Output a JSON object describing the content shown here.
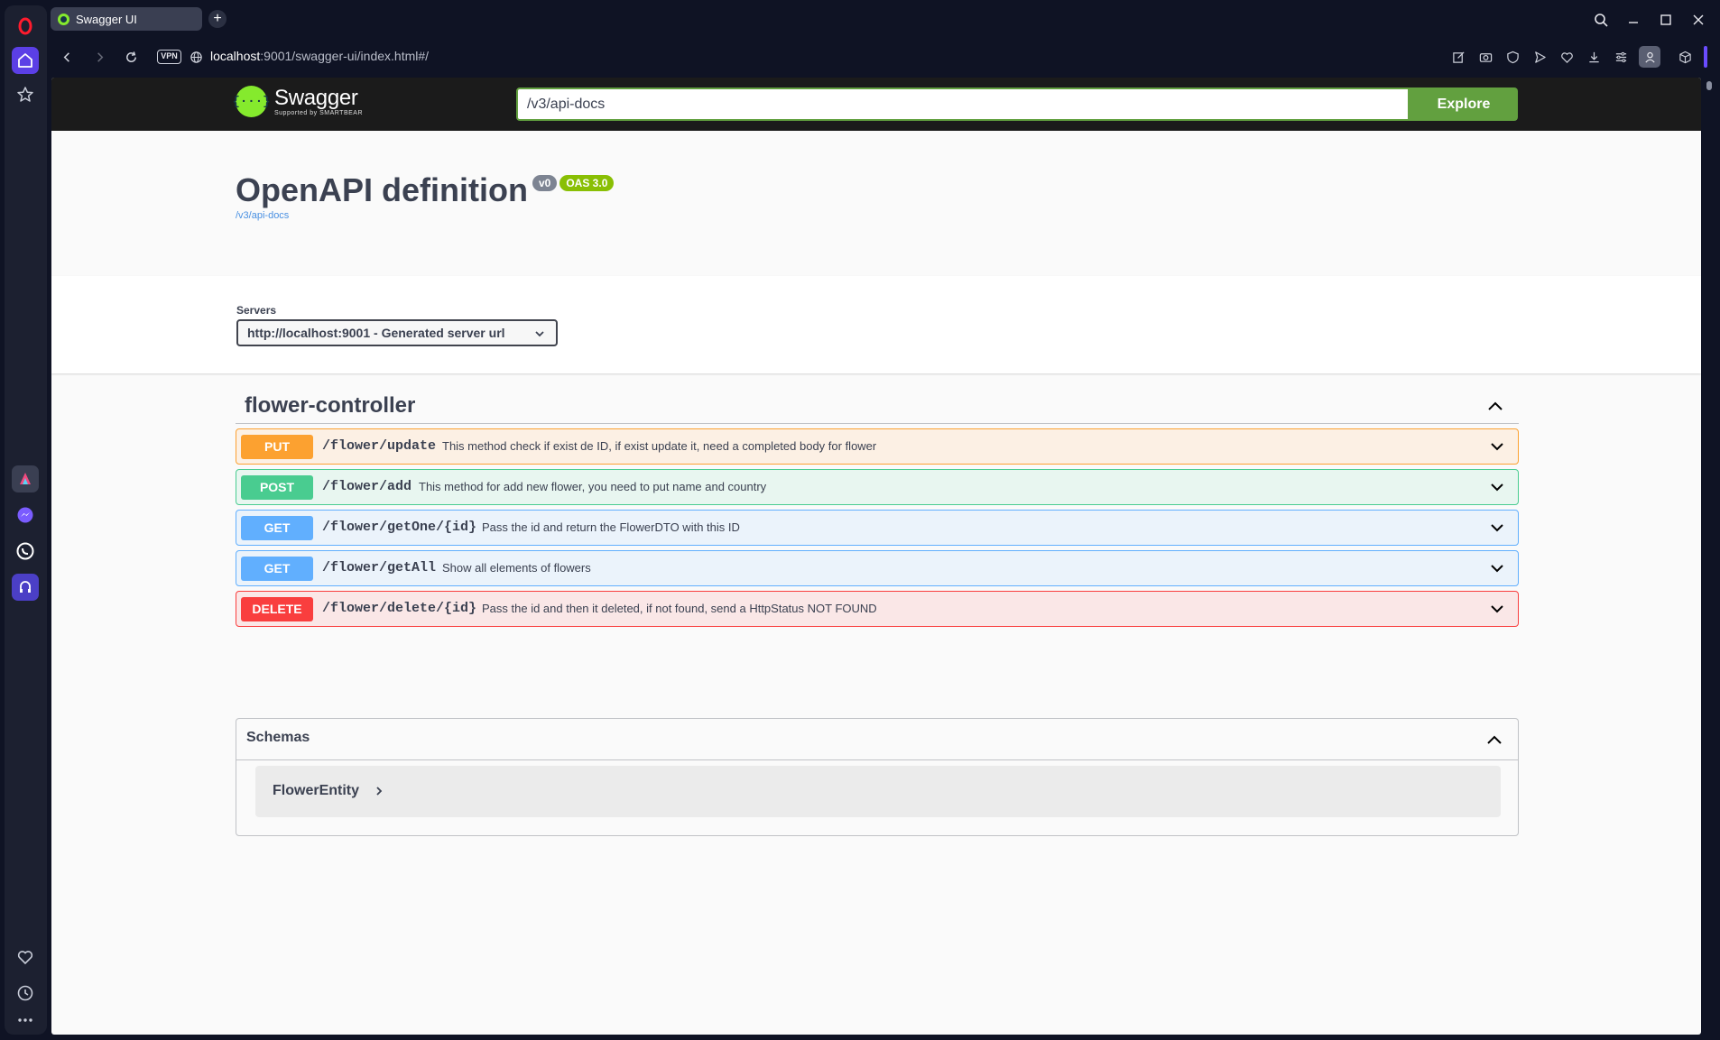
{
  "browser": {
    "tab_title": "Swagger UI",
    "new_tab_label": "+",
    "vpn_label": "VPN",
    "url_host": "localhost",
    "url_path": ":9001/swagger-ui/index.html#/"
  },
  "swagger": {
    "logo_text": "Swagger",
    "logo_sub": "Supported by SMARTBEAR",
    "logo_mark": "{···}",
    "spec_url": "/v3/api-docs",
    "explore_label": "Explore"
  },
  "info": {
    "title": "OpenAPI definition",
    "version": "v0",
    "oas": "OAS 3.0",
    "spec_link": "/v3/api-docs"
  },
  "servers": {
    "label": "Servers",
    "selected": "http://localhost:9001 - Generated server url"
  },
  "tag": {
    "name": "flower-controller",
    "operations": [
      {
        "method": "PUT",
        "path": "/flower/update",
        "summary": "This method check if exist de ID, if exist update it, need a completed body for flower"
      },
      {
        "method": "POST",
        "path": "/flower/add",
        "summary": "This method for add new flower, you need to put name and country"
      },
      {
        "method": "GET",
        "path": "/flower/getOne/{id}",
        "summary": "Pass the id and return the FlowerDTO with this ID"
      },
      {
        "method": "GET",
        "path": "/flower/getAll",
        "summary": "Show all elements of flowers"
      },
      {
        "method": "DELETE",
        "path": "/flower/delete/{id}",
        "summary": "Pass the id and then it deleted, if not found, send a HttpStatus NOT FOUND"
      }
    ]
  },
  "schemas": {
    "title": "Schemas",
    "models": [
      "FlowerEntity"
    ]
  },
  "colors": {
    "put": "#fca130",
    "post": "#49cc90",
    "get": "#61affe",
    "delete": "#f93e3e",
    "swagger_green": "#62a03f"
  }
}
